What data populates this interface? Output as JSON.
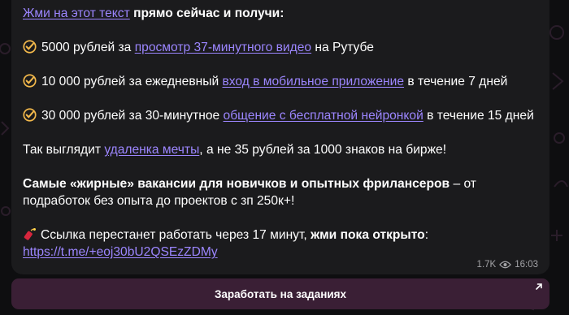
{
  "message": {
    "intro_link": "Жми на этот текст",
    "intro_rest": " прямо сейчас и получи:",
    "offers": [
      {
        "pre": "5000 рублей за ",
        "link": "просмотр 37-минутного видео",
        "post": " на Рутубе"
      },
      {
        "pre": "10 000 рублей за ежедневный ",
        "link": "вход в мобильное приложение",
        "post": " в течение 7 дней"
      },
      {
        "pre": "30 000 рублей за 30-минутное ",
        "link": "общение с бесплатной нейронкой",
        "post": " в течение 15 дней"
      }
    ],
    "line4_pre": "Так выглядит ",
    "line4_link": "удаленка мечты",
    "line4_post": ", а не 35 рублей за 1000 знаков на бирже!",
    "line5_bold": "Самые «жирные» вакансии для новичков и опытных фрилансеров",
    "line5_rest": " – от подработок без опыта до проектов с зп 250к+!",
    "line6_pre": "Ссылка перестанет работать через 17 минут, ",
    "line6_bold": "жми пока открыто",
    "line6_colon": ":",
    "invite_link": "https://t.me/+eoj30bU2QSEzZDMy",
    "views": "1.7K",
    "time": "16:03"
  },
  "button": {
    "label": "Заработать на заданиях"
  },
  "icons": {
    "check": "check-circle-emoji-icon",
    "firecracker": "firecracker-emoji-icon",
    "eye": "eye-icon",
    "arrow": "arrow-up-right-icon"
  },
  "colors": {
    "link": "#9c86ff",
    "bubble": "#1b1b1d",
    "button": "#3a1f35",
    "background": "#0e0e10"
  }
}
